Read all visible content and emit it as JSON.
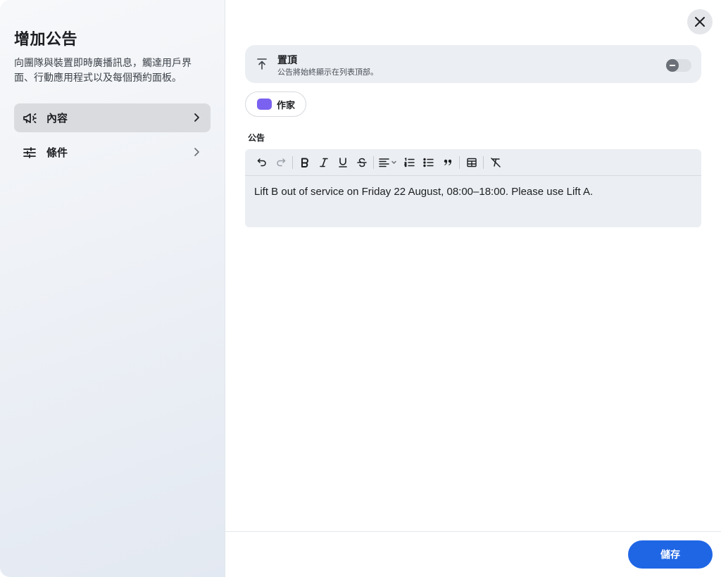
{
  "sidebar": {
    "title": "增加公告",
    "description": "向團隊與裝置即時廣播訊息，觸達用戶界面、行動應用程式以及每個預約面板。",
    "items": [
      {
        "label": "內容",
        "icon": "megaphone-icon",
        "active": true
      },
      {
        "label": "條件",
        "icon": "sliders-icon",
        "active": false
      }
    ]
  },
  "pin": {
    "title": "置頂",
    "subtitle": "公告將始終顯示在列表頂部。",
    "enabled": false
  },
  "author": {
    "label": "作家",
    "color": "#7b61f0"
  },
  "announcement": {
    "label": "公告",
    "text": "Lift B out of service on Friday 22 August, 08:00–18:00. Please use Lift A."
  },
  "toolbar": {
    "icons": [
      "undo-icon",
      "redo-icon",
      "bold-icon",
      "italic-icon",
      "underline-icon",
      "strikethrough-icon",
      "align-icon",
      "ordered-list-icon",
      "bullet-list-icon",
      "quote-icon",
      "table-icon",
      "clear-format-icon"
    ]
  },
  "footer": {
    "save_label": "儲存"
  },
  "colors": {
    "accent": "#1f66e5",
    "author_swatch": "#7b61f0"
  }
}
